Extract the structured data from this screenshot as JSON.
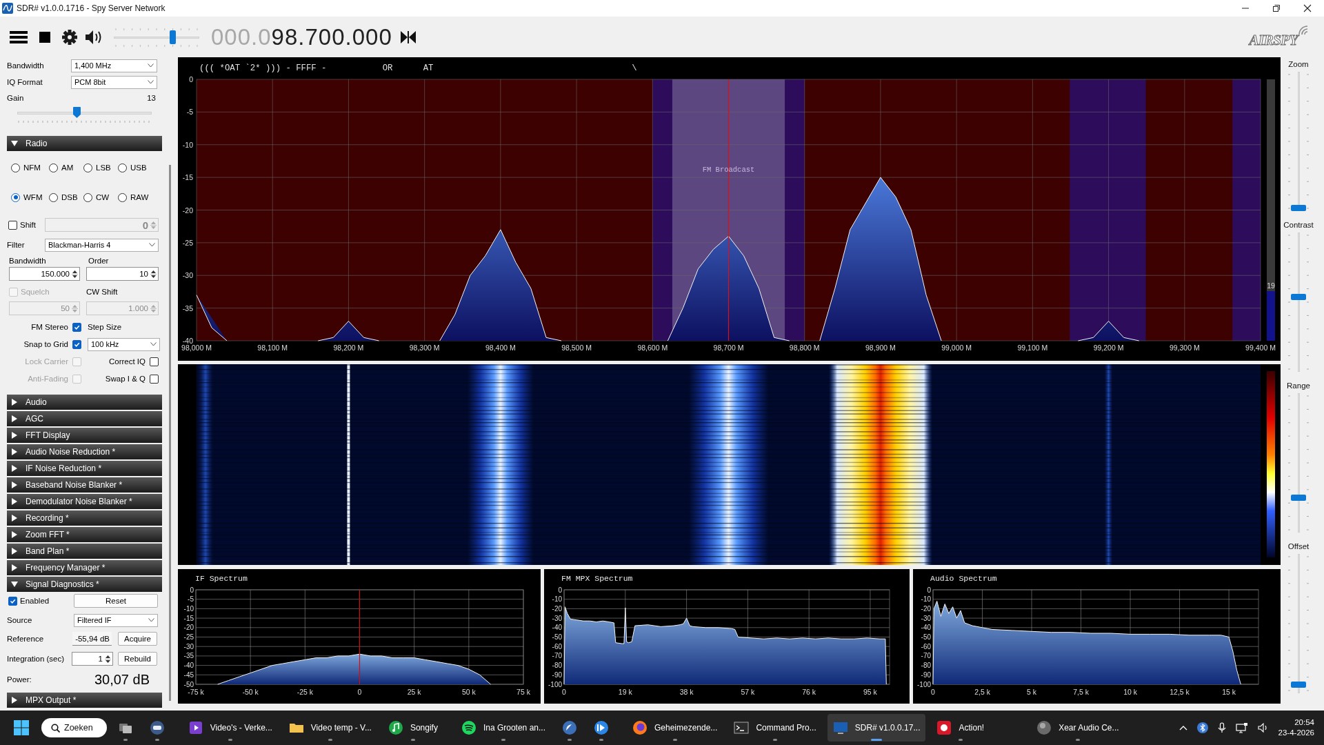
{
  "window": {
    "title": "SDR# v1.0.0.1716 - Spy Server Network"
  },
  "toolbar": {
    "volume": {
      "level": 0.7
    },
    "frequency_dim": "000.0",
    "frequency": "98.700.000",
    "logo": "AIRSPY"
  },
  "source": {
    "bandwidth_label": "Bandwidth",
    "bandwidth": "1,400 MHz",
    "iq_format_label": "IQ Format",
    "iq_format": "PCM 8bit",
    "gain_label": "Gain",
    "gain_value": "13",
    "gain": {
      "level": 0.44
    }
  },
  "panels": [
    {
      "title": "Radio",
      "expanded": true,
      "kind": "radio"
    },
    {
      "title": "Audio",
      "expanded": false
    },
    {
      "title": "AGC",
      "expanded": false
    },
    {
      "title": "FFT Display",
      "expanded": false
    },
    {
      "title": "Audio Noise Reduction *",
      "expanded": false
    },
    {
      "title": "IF Noise Reduction *",
      "expanded": false
    },
    {
      "title": "Baseband Noise Blanker *",
      "expanded": false
    },
    {
      "title": "Demodulator Noise Blanker *",
      "expanded": false
    },
    {
      "title": "Recording *",
      "expanded": false
    },
    {
      "title": "Zoom FFT *",
      "expanded": false
    },
    {
      "title": "Band Plan *",
      "expanded": false
    },
    {
      "title": "Frequency Manager *",
      "expanded": false
    },
    {
      "title": "Signal Diagnostics *",
      "expanded": true,
      "kind": "diagnostics"
    },
    {
      "title": "MPX Output *",
      "expanded": false
    }
  ],
  "radio": {
    "modes": [
      {
        "label": "NFM",
        "selected": false
      },
      {
        "label": "AM",
        "selected": false
      },
      {
        "label": "LSB",
        "selected": false
      },
      {
        "label": "USB",
        "selected": false
      },
      {
        "label": "WFM",
        "selected": true
      },
      {
        "label": "DSB",
        "selected": false
      },
      {
        "label": "CW",
        "selected": false
      },
      {
        "label": "RAW",
        "selected": false
      }
    ],
    "shift": {
      "label": "Shift",
      "checked": false,
      "value": "0"
    },
    "filter_label": "Filter",
    "filter": "Blackman-Harris 4",
    "bandwidth_label": "Bandwidth",
    "bandwidth": "150.000",
    "order_label": "Order",
    "order": "10",
    "squelch": {
      "label": "Squelch",
      "checked": false,
      "disabled": true,
      "value": "50"
    },
    "cw_shift_label": "CW Shift",
    "cw_shift": {
      "value": "1.000",
      "disabled": true
    },
    "options_left": [
      {
        "label": "FM Stereo",
        "checked": true,
        "disabled": false
      },
      {
        "label": "Snap to Grid",
        "checked": true,
        "disabled": false
      },
      {
        "label": "Lock Carrier",
        "checked": false,
        "disabled": true
      },
      {
        "label": "Anti-Fading",
        "checked": false,
        "disabled": true
      }
    ],
    "step_size_label": "Step Size",
    "step_size": "100 kHz",
    "options_right": [
      {
        "label": "Correct IQ",
        "checked": false
      },
      {
        "label": "Swap I & Q",
        "checked": false
      }
    ]
  },
  "diagnostics": {
    "enabled": {
      "label": "Enabled",
      "checked": true
    },
    "reset": "Reset",
    "source_label": "Source",
    "source": "Filtered IF",
    "reference_label": "Reference",
    "reference": "-55,94 dB",
    "acquire": "Acquire",
    "integration_label": "Integration (sec)",
    "integration": "1",
    "rebuild": "Rebuild",
    "power_label": "Power:",
    "power": "30,07 dB"
  },
  "spectrum": {
    "rds": "((( *OAT `2* ))) - FFFF -           OR      AT                                       \\",
    "band_label": "FM Broadcast",
    "meter": {
      "level": 0.19,
      "reading": "19"
    },
    "chart_data": {
      "type": "area",
      "grid": true,
      "ylim": [
        -40,
        0
      ],
      "yticks": [
        0,
        -5,
        -10,
        -15,
        -20,
        -25,
        -30,
        -35,
        -40
      ],
      "categories": [
        "98,000 M",
        null,
        null,
        null,
        null,
        "98,100 M",
        null,
        null,
        null,
        null,
        "98,200 M",
        null,
        null,
        null,
        null,
        "98,300 M",
        null,
        null,
        null,
        null,
        "98,400 M",
        null,
        null,
        null,
        null,
        "98,500 M",
        null,
        null,
        null,
        null,
        "98,600 M",
        null,
        null,
        null,
        null,
        "98,700 M",
        null,
        null,
        null,
        null,
        "98,800 M",
        null,
        null,
        null,
        null,
        "98,900 M",
        null,
        null,
        null,
        null,
        "99,000 M",
        null,
        null,
        null,
        null,
        "99,100 M",
        null,
        null,
        null,
        null,
        "99,200 M",
        null,
        null,
        null,
        null,
        "99,300 M",
        null,
        null,
        null,
        null,
        "99,400 M"
      ],
      "series": [
        {
          "color": "#f4f4f4",
          "values": [
            -33,
            -38,
            -40,
            null,
            null,
            null,
            null,
            null,
            -40,
            -39.5,
            -37,
            -39.5,
            -40,
            null,
            null,
            null,
            -40,
            -36,
            -30,
            -27,
            -23,
            -28,
            -32,
            -39.5,
            -40,
            null,
            null,
            null,
            null,
            null,
            null,
            -40,
            -35,
            -29,
            -26,
            -24,
            -27,
            -32,
            -39.5,
            -40,
            null,
            -40,
            -32,
            -23,
            -19,
            -15,
            -18,
            -23,
            -33,
            -40,
            null,
            null,
            null,
            null,
            null,
            null,
            null,
            null,
            -40,
            -39.5,
            -37,
            -39.5,
            -40,
            null,
            null,
            null,
            null,
            null,
            null,
            null,
            null
          ]
        }
      ]
    }
  },
  "small_spectra": [
    {
      "title": "IF Spectrum",
      "chart_data": {
        "type": "area",
        "grid": true,
        "xlim": [
          -75,
          75
        ],
        "ylim": [
          -50,
          0
        ],
        "yticks": [
          0,
          -5,
          -10,
          -15,
          -20,
          -25,
          -30,
          -35,
          -40,
          -45,
          -50
        ],
        "xticks": [
          {
            "value": -75,
            "label": "-75 k"
          },
          {
            "value": -50,
            "label": "-50 k"
          },
          {
            "value": -25,
            "label": "-25 k"
          },
          {
            "value": 0,
            "label": "0"
          },
          {
            "value": 25,
            "label": "25 k"
          },
          {
            "value": 50,
            "label": "50 k"
          },
          {
            "value": 75,
            "label": "75 k"
          }
        ],
        "ref_lines": [
          {
            "axis": "x",
            "value": 0,
            "color": "#d01010"
          }
        ],
        "x": [
          -65,
          -60,
          -55,
          -50,
          -45,
          -40,
          -35,
          -30,
          -25,
          -20,
          -15,
          -10,
          -5,
          0,
          5,
          10,
          15,
          20,
          25,
          30,
          35,
          40,
          45,
          50,
          55,
          60
        ],
        "series": [
          {
            "color": "#f4f4f4",
            "values": [
              -50,
              -48,
              -46,
              -44,
              -42,
              -40,
              -39,
              -38,
              -37,
              -36,
              -36,
              -35,
              -35,
              -34,
              -35,
              -35,
              -36,
              -36,
              -36,
              -37,
              -38,
              -39,
              -40,
              -42,
              -45,
              -50
            ]
          }
        ]
      }
    },
    {
      "title": "FM MPX Spectrum",
      "chart_data": {
        "type": "area",
        "grid": true,
        "xlim": [
          0,
          101
        ],
        "ylim": [
          -100,
          0
        ],
        "yticks": [
          0,
          -10,
          -20,
          -30,
          -40,
          -50,
          -60,
          -70,
          -80,
          -90,
          -100
        ],
        "xticks": [
          {
            "value": 0,
            "label": "0"
          },
          {
            "value": 19,
            "label": "19 k"
          },
          {
            "value": 38,
            "label": "38 k"
          },
          {
            "value": 57,
            "label": "57 k"
          },
          {
            "value": 76,
            "label": "76 k"
          },
          {
            "value": 95,
            "label": "95 k"
          }
        ],
        "x": [
          0,
          0.3,
          1,
          2,
          4,
          6,
          8,
          10,
          12,
          14,
          15.5,
          16,
          18,
          18.6,
          19,
          19.4,
          20,
          21,
          22,
          26,
          30,
          34,
          36,
          37,
          38,
          39,
          40,
          44,
          48,
          52,
          53,
          54,
          58,
          62,
          66,
          70,
          74,
          78,
          82,
          86,
          90,
          94,
          98,
          99.7,
          100
        ],
        "series": [
          {
            "color": "#f4f4f4",
            "values": [
              -100,
              -18,
              -25,
              -31,
              -32,
              -33,
              -33,
              -34,
              -33,
              -34,
              -35,
              -56,
              -57,
              -57,
              -19,
              -55,
              -56,
              -55,
              -38,
              -37,
              -39,
              -38,
              -37,
              -36,
              -30,
              -38,
              -39,
              -40,
              -40,
              -41,
              -42,
              -50,
              -51,
              -52,
              -51,
              -52,
              -51,
              -52,
              -51,
              -52,
              -52,
              -51,
              -52,
              -52,
              -100
            ]
          }
        ]
      }
    },
    {
      "title": "Audio Spectrum",
      "chart_data": {
        "type": "area",
        "grid": true,
        "xlim": [
          0,
          16.5
        ],
        "ylim": [
          -100,
          0
        ],
        "yticks": [
          0,
          -10,
          -20,
          -30,
          -40,
          -50,
          -60,
          -70,
          -80,
          -90,
          -100
        ],
        "xticks": [
          {
            "value": 0,
            "label": "0"
          },
          {
            "value": 2.5,
            "label": "2,5 k"
          },
          {
            "value": 5,
            "label": "5 k"
          },
          {
            "value": 7.5,
            "label": "7,5 k"
          },
          {
            "value": 10,
            "label": "10 k"
          },
          {
            "value": 12.5,
            "label": "12,5 k"
          },
          {
            "value": 15,
            "label": "15 k"
          }
        ],
        "x": [
          0,
          0.05,
          0.2,
          0.4,
          0.6,
          0.8,
          1,
          1.2,
          1.4,
          1.6,
          2,
          2.5,
          3,
          4,
          5,
          6,
          7,
          8,
          9,
          10,
          11,
          12,
          13,
          14,
          14.6,
          15,
          15.2,
          15.4,
          15.6
        ],
        "series": [
          {
            "color": "#f4f4f4",
            "values": [
              -100,
              -20,
              -12,
              -28,
              -15,
              -25,
              -18,
              -30,
              -22,
              -35,
              -38,
              -40,
              -42,
              -43,
              -44,
              -45,
              -45,
              -46,
              -46,
              -47,
              -47,
              -47,
              -48,
              -48,
              -48,
              -50,
              -65,
              -85,
              -100
            ]
          }
        ]
      }
    }
  ],
  "sliders": [
    {
      "label": "Zoom",
      "level": 0
    },
    {
      "label": "Contrast",
      "level": 0.54
    },
    {
      "label": "Range",
      "level": 0.24
    },
    {
      "label": "Offset",
      "level": 0.04
    }
  ],
  "taskbar": {
    "search": "Zoeken",
    "apps": [
      {
        "selected": false
      },
      {
        "selected": false
      },
      {
        "label": "Video's - Verke...",
        "selected": false
      },
      {
        "label": "Video temp - V...",
        "selected": false
      },
      {
        "label": "Songify",
        "selected": false
      },
      {
        "label": "Ina Grooten an...",
        "selected": false
      },
      {
        "selected": false
      },
      {
        "selected": false
      },
      {
        "label": "Geheimezende...",
        "selected": false
      },
      {
        "label": "Command Pro...",
        "selected": false
      },
      {
        "label": "SDR# v1.0.0.17...",
        "selected": true
      },
      {
        "label": "Action!",
        "selected": false
      },
      {
        "label": "Xear Audio Ce...",
        "selected": false
      }
    ],
    "time": "20:54",
    "date": "23-4-2026"
  }
}
